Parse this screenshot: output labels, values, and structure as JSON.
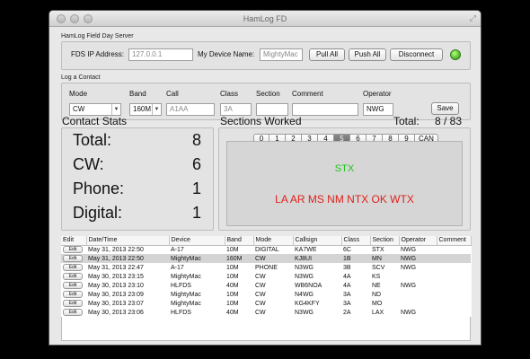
{
  "window": {
    "title": "HamLog FD"
  },
  "server": {
    "group_label": "HamLog Field Day Server",
    "fds_ip_label": "FDS IP Address:",
    "fds_ip_placeholder": "127.0.0.1",
    "device_name_label": "My Device Name:",
    "device_name_placeholder": "MightyMac",
    "pull_all": "Pull All",
    "push_all": "Push All",
    "disconnect": "Disconnect",
    "status_color": "#4caf2a"
  },
  "log_contact": {
    "group_label": "Log a Contact",
    "mode_label": "Mode",
    "mode_value": "CW",
    "band_label": "Band",
    "band_value": "160M",
    "call_label": "Call",
    "call_placeholder": "A1AA",
    "class_label": "Class",
    "class_placeholder": "3A",
    "section_label": "Section",
    "section_value": "",
    "comment_label": "Comment",
    "comment_value": "",
    "operator_label": "Operator",
    "operator_value": "NWG",
    "save": "Save"
  },
  "contact_stats": {
    "heading": "Contact Stats",
    "rows": [
      {
        "label": "Total:",
        "value": "8"
      },
      {
        "label": "CW:",
        "value": "6"
      },
      {
        "label": "Phone:",
        "value": "1"
      },
      {
        "label": "Digital:",
        "value": "1"
      }
    ]
  },
  "sections_worked": {
    "heading": "Sections Worked",
    "total_label": "Total:",
    "total_value": "8 / 83",
    "tabs": [
      "0",
      "1",
      "2",
      "3",
      "4",
      "5",
      "6",
      "7",
      "8",
      "9",
      "CAN"
    ],
    "selected_tab": "5",
    "green_sections": "STX",
    "red_sections": "LA AR MS NM NTX OK WTX",
    "green_color": "#22c522",
    "red_color": "#e0201a"
  },
  "log_table": {
    "columns": [
      "Edit",
      "Date/Time",
      "Device",
      "Band",
      "Mode",
      "Callsign",
      "Class",
      "Section",
      "Operator",
      "Comment"
    ],
    "edit_label": "Edit",
    "rows": [
      {
        "dt": "May 31, 2013 22:50",
        "device": "A-17",
        "band": "10M",
        "mode": "DIGITAL",
        "call": "KA7WE",
        "class": "6C",
        "section": "STX",
        "op": "NWG",
        "comment": ""
      },
      {
        "dt": "May 31, 2013 22:50",
        "device": "MightyMac",
        "band": "160M",
        "mode": "CW",
        "call": "KJ8UI",
        "class": "1B",
        "section": "MN",
        "op": "NWG",
        "comment": ""
      },
      {
        "dt": "May 31, 2013 22:47",
        "device": "A-17",
        "band": "10M",
        "mode": "PHONE",
        "call": "N3WG",
        "class": "3B",
        "section": "SCV",
        "op": "NWG",
        "comment": ""
      },
      {
        "dt": "May 30, 2013 23:15",
        "device": "MightyMac",
        "band": "10M",
        "mode": "CW",
        "call": "N3WG",
        "class": "4A",
        "section": "KS",
        "op": "",
        "comment": ""
      },
      {
        "dt": "May 30, 2013 23:10",
        "device": "HLFDS",
        "band": "40M",
        "mode": "CW",
        "call": "WB6NOA",
        "class": "4A",
        "section": "NE",
        "op": "NWG",
        "comment": ""
      },
      {
        "dt": "May 30, 2013 23:09",
        "device": "MightyMac",
        "band": "10M",
        "mode": "CW",
        "call": "N4WG",
        "class": "3A",
        "section": "ND",
        "op": "",
        "comment": ""
      },
      {
        "dt": "May 30, 2013 23:07",
        "device": "MightyMac",
        "band": "10M",
        "mode": "CW",
        "call": "KG4KFY",
        "class": "3A",
        "section": "MO",
        "op": "",
        "comment": ""
      },
      {
        "dt": "May 30, 2013 23:06",
        "device": "HLFDS",
        "band": "40M",
        "mode": "CW",
        "call": "N3WG",
        "class": "2A",
        "section": "LAX",
        "op": "NWG",
        "comment": ""
      }
    ]
  }
}
